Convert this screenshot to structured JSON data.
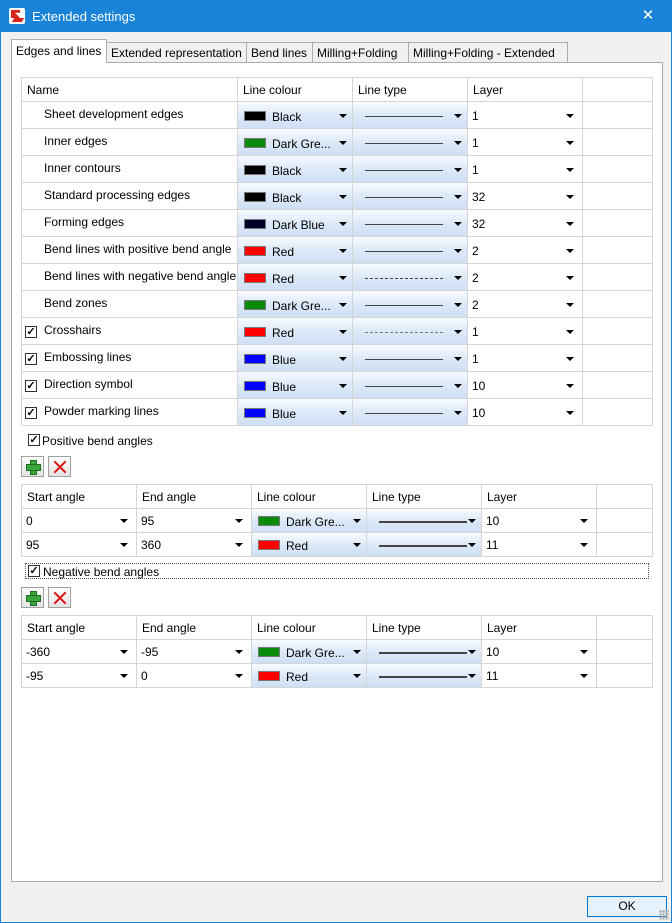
{
  "window": {
    "title": "Extended settings",
    "close_glyph": "✕"
  },
  "tabs": [
    {
      "label": "Edges and lines"
    },
    {
      "label": "Extended representation"
    },
    {
      "label": "Bend lines"
    },
    {
      "label": "Milling+Folding"
    },
    {
      "label": "Milling+Folding - Extended"
    }
  ],
  "edges": {
    "headers": {
      "name": "Name",
      "colour": "Line colour",
      "type": "Line type",
      "layer": "Layer"
    },
    "rows": [
      {
        "checkbox": false,
        "name": "Sheet development edges",
        "colour_name": "Black",
        "colour": "#000000",
        "line": "solid",
        "layer": "1"
      },
      {
        "checkbox": false,
        "name": "Inner edges",
        "colour_name": "Dark Gre...",
        "colour": "#0a8a0a",
        "line": "solid",
        "layer": "1"
      },
      {
        "checkbox": false,
        "name": "Inner contours",
        "colour_name": "Black",
        "colour": "#000000",
        "line": "solid",
        "layer": "1"
      },
      {
        "checkbox": false,
        "name": "Standard processing edges",
        "colour_name": "Black",
        "colour": "#000000",
        "line": "solid",
        "layer": "32"
      },
      {
        "checkbox": false,
        "name": "Forming edges",
        "colour_name": "Dark Blue",
        "colour": "#000028",
        "line": "solid",
        "layer": "32"
      },
      {
        "checkbox": false,
        "name": "Bend lines with positive bend angle",
        "colour_name": "Red",
        "colour": "#ff0000",
        "line": "solid",
        "layer": "2"
      },
      {
        "checkbox": false,
        "name": "Bend lines with negative bend angle",
        "colour_name": "Red",
        "colour": "#ff0000",
        "line": "dashed",
        "layer": "2"
      },
      {
        "checkbox": false,
        "name": "Bend zones",
        "colour_name": "Dark Gre...",
        "colour": "#0a8a0a",
        "line": "solid",
        "layer": "2"
      },
      {
        "checkbox": true,
        "name": "Crosshairs",
        "colour_name": "Red",
        "colour": "#ff0000",
        "line": "dashdot",
        "layer": "1"
      },
      {
        "checkbox": true,
        "name": "Embossing lines",
        "colour_name": "Blue",
        "colour": "#0000ff",
        "line": "solid",
        "layer": "1"
      },
      {
        "checkbox": true,
        "name": "Direction symbol",
        "colour_name": "Blue",
        "colour": "#0000ff",
        "line": "solid",
        "layer": "10"
      },
      {
        "checkbox": true,
        "name": "Powder marking lines",
        "colour_name": "Blue",
        "colour": "#0000ff",
        "line": "solid",
        "layer": "10"
      }
    ]
  },
  "positive": {
    "label": "Positive bend angles",
    "checked": true,
    "headers": {
      "start": "Start angle",
      "end": "End angle",
      "colour": "Line colour",
      "type": "Line type",
      "layer": "Layer"
    },
    "rows": [
      {
        "start": "0",
        "end": "95",
        "colour_name": "Dark Gre...",
        "colour": "#0a8a0a",
        "layer": "10"
      },
      {
        "start": "95",
        "end": "360",
        "colour_name": "Red",
        "colour": "#ff0000",
        "layer": "11"
      }
    ]
  },
  "negative": {
    "label": "Negative bend angles",
    "checked": true,
    "headers": {
      "start": "Start angle",
      "end": "End angle",
      "colour": "Line colour",
      "type": "Line type",
      "layer": "Layer"
    },
    "rows": [
      {
        "start": "-360",
        "end": "-95",
        "colour_name": "Dark Gre...",
        "colour": "#0a8a0a",
        "layer": "10"
      },
      {
        "start": "-95",
        "end": "0",
        "colour_name": "Red",
        "colour": "#ff0000",
        "layer": "11"
      }
    ]
  },
  "buttons": {
    "ok": "OK"
  }
}
